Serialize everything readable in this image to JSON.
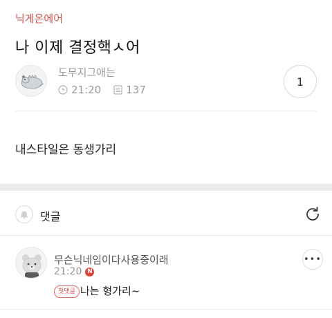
{
  "board": {
    "name": "닉게온에어"
  },
  "post": {
    "title": "나 이제 결정핵ㅅ어",
    "author": "도무지그애는",
    "time": "21:20",
    "views": "137",
    "comment_count": "1",
    "body": "내스타일은 동생가리"
  },
  "comments_section": {
    "header": "댓글"
  },
  "comments": [
    {
      "author": "무슨닉네임이다사용중이래",
      "time": "21:20",
      "new_badge": "N",
      "first_badge": "첫댓글",
      "text": "나는 형가리~",
      "more_label": "•••"
    }
  ],
  "icons": {
    "post_avatar": "dinosaur-avatar-icon",
    "clock": "clock-icon",
    "views": "document-icon",
    "bell": "bell-icon",
    "refresh": "refresh-icon",
    "comment_avatar": "bear-avatar-icon"
  },
  "colors": {
    "accent": "#d4554f",
    "new_badge": "#e0423a",
    "muted_text": "#9a9a9a"
  }
}
